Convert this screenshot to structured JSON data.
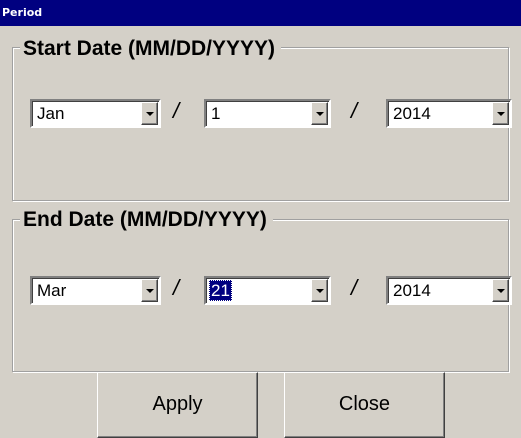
{
  "window": {
    "title": "Period"
  },
  "start": {
    "legend": "Start Date (MM/DD/YYYY)",
    "month": "Jan",
    "day": "1",
    "year": "2014"
  },
  "end": {
    "legend": "End Date (MM/DD/YYYY)",
    "month": "Mar",
    "day": "21",
    "year": "2014"
  },
  "separator": "/",
  "buttons": {
    "apply": "Apply",
    "close": "Close"
  },
  "colors": {
    "titlebar": "#000080",
    "face": "#d4d0c8",
    "selection": "#000080"
  },
  "icons": {
    "dropdown": "chevron-down-icon"
  }
}
